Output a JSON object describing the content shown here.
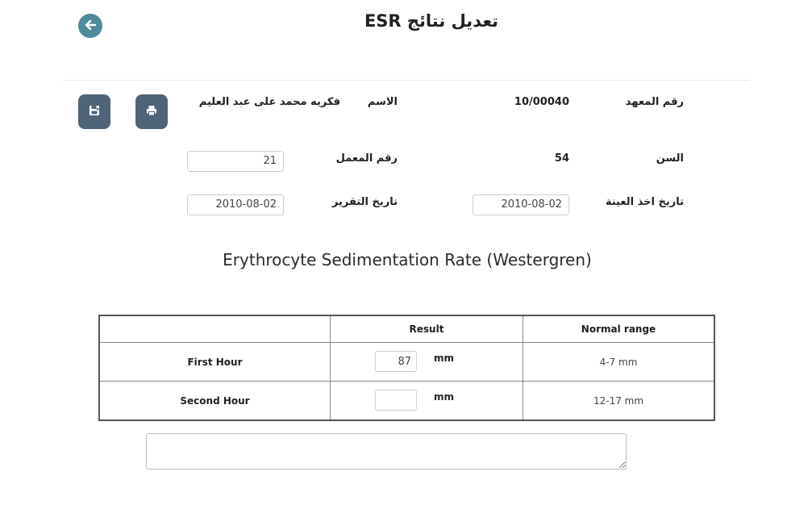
{
  "header": {
    "title": "تعديل نتائج ESR"
  },
  "patient": {
    "institute_no_label": "رقم المعهد",
    "institute_no_value": "10/00040",
    "name_label": "الاسم",
    "name_value": "فكريه محمد على عبد العليم",
    "age_label": "السن",
    "age_value": "54",
    "lab_no_label": "رقم المعمل",
    "lab_no_value": "21",
    "sample_date_label": "تاريخ اخذ العينة",
    "sample_date_value": "2010-08-02",
    "report_date_label": "تاريخ التقرير",
    "report_date_value": "2010-08-02"
  },
  "toolbar": {
    "save_icon": "save-icon",
    "print_icon": "print-icon",
    "back_icon": "arrow-left-icon"
  },
  "test": {
    "title": "Erythrocyte Sedimentation Rate (Westergren)",
    "columns": [
      "",
      "Result",
      "Normal range"
    ],
    "rows": [
      {
        "name": "First Hour",
        "result": "87",
        "unit": "mm",
        "range": "4-7 mm"
      },
      {
        "name": "Second Hour",
        "result": "",
        "unit": "mm",
        "range": "12-17 mm"
      }
    ]
  },
  "notes": {
    "value": ""
  },
  "colors": {
    "back_button": "#4f8a99",
    "action_buttons": "#4f6478"
  }
}
